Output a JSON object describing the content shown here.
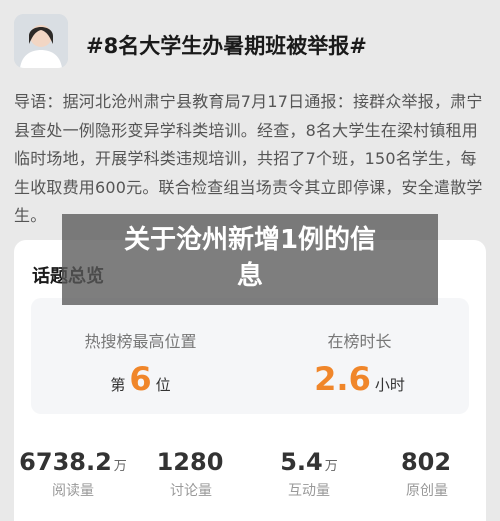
{
  "header": {
    "title": "#8名大学生办暑期班被举报#"
  },
  "intro": {
    "text": "导语：据河北沧州肃宁县教育局7月17日通报：接群众举报，肃宁县查处一例隐形变异学科类培训。经查，8名大学生在梁村镇租用临时场地，开展学科类违规培训，共招了7个班，150名学生，每生收取费用600元。联合检查组当场责令其立即停课，安全遣散学生。"
  },
  "overlay": {
    "line1": "关于沧州新增1例的信",
    "line2": "息"
  },
  "summary": {
    "title": "话题总览",
    "hot_rank": {
      "label": "热搜榜最高位置",
      "prefix": "第",
      "value": "6",
      "suffix": "位"
    },
    "duration": {
      "label": "在榜时长",
      "value": "2.6",
      "suffix": "小时"
    },
    "stats": [
      {
        "value": "6738.2",
        "unit": "万",
        "caption": "阅读量"
      },
      {
        "value": "1280",
        "unit": "",
        "caption": "讨论量"
      },
      {
        "value": "5.4",
        "unit": "万",
        "caption": "互动量"
      },
      {
        "value": "802",
        "unit": "",
        "caption": "原创量"
      }
    ]
  },
  "colors": {
    "accent": "#f0862a",
    "overlay": "#5a5a5a"
  }
}
